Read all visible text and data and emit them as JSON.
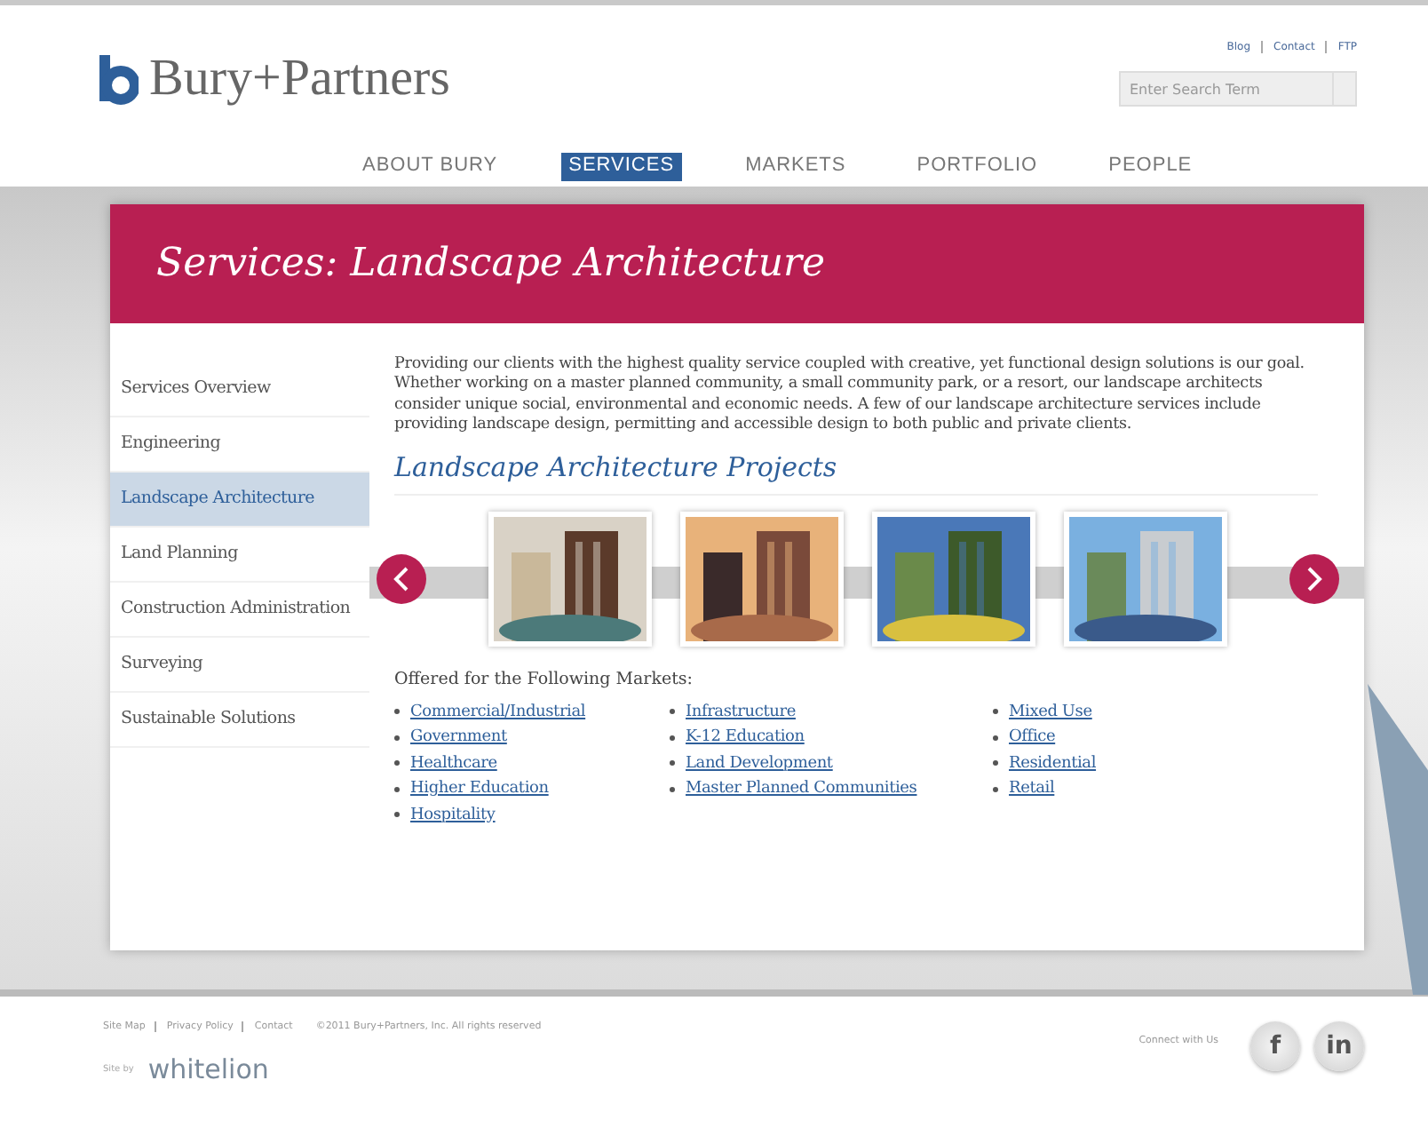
{
  "header": {
    "logo_text": "Bury+Partners",
    "utility_links": [
      "Blog",
      "Contact",
      "FTP"
    ],
    "search": {
      "placeholder": "Enter Search Term"
    }
  },
  "nav": [
    {
      "label": "ABOUT BURY",
      "selected": false
    },
    {
      "label": "SERVICES",
      "selected": true
    },
    {
      "label": "MARKETS",
      "selected": false
    },
    {
      "label": "PORTFOLIO",
      "selected": false
    },
    {
      "label": "PEOPLE",
      "selected": false
    }
  ],
  "banner": {
    "title": "Services: Landscape Architecture"
  },
  "sidebar": {
    "items": [
      {
        "label": "Services Overview",
        "selected": false
      },
      {
        "label": "Engineering",
        "selected": false
      },
      {
        "label": "Landscape Architecture",
        "selected": true
      },
      {
        "label": "Land Planning",
        "selected": false
      },
      {
        "label": "Construction Administration",
        "selected": false
      },
      {
        "label": "Surveying",
        "selected": false
      },
      {
        "label": "Sustainable Solutions",
        "selected": false
      }
    ]
  },
  "intro": "Providing our clients with the highest quality service coupled with creative, yet functional design solutions is our goal. Whether working on a master planned community, a small community park, or a resort, our landscape architects consider unique social, environmental and economic needs. A few of our landscape architecture services include providing landscape design, permitting and accessible design to both public and private clients.",
  "projects": {
    "heading": "Landscape Architecture Projects"
  },
  "markets": {
    "heading": "Offered for the Following Markets:",
    "columns": [
      [
        "Commercial/Industrial",
        "Government",
        "Healthcare",
        "Higher Education",
        "Hospitality"
      ],
      [
        "Infrastructure",
        "K-12 Education",
        "Land Development",
        "Master Planned Communities"
      ],
      [
        "Mixed Use",
        "Office",
        "Residential",
        "Retail"
      ]
    ]
  },
  "footer": {
    "links": [
      "Site Map",
      "Privacy Policy",
      "Contact"
    ],
    "copyright": "©2011 Bury+Partners, Inc. All rights reserved",
    "connect": "Connect with Us",
    "social": [
      "f",
      "in"
    ],
    "credit_label": "Site by",
    "credit": "whitelion"
  }
}
